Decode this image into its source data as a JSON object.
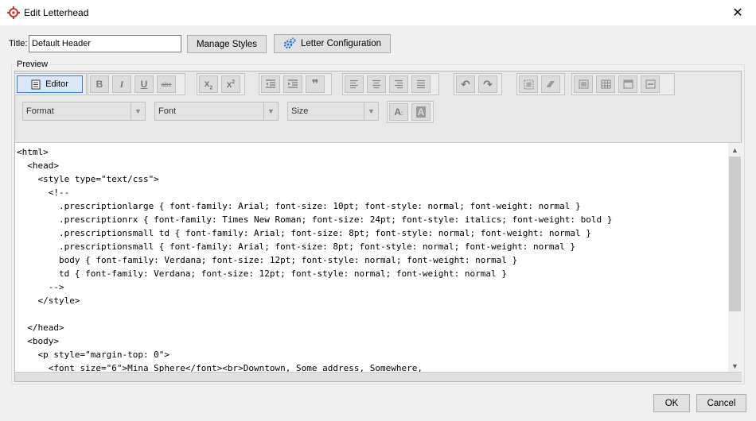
{
  "window": {
    "title": "Edit Letterhead",
    "app_icon": "target-crosshair-icon",
    "close_label": "✕"
  },
  "form": {
    "title_label": "Title:",
    "title_value": "Default Header",
    "manage_styles_label": "Manage Styles",
    "letter_config_label": "Letter Configuration",
    "preview_label": "Preview"
  },
  "toolbar": {
    "editor_label": "Editor",
    "format_selected": "Format",
    "font_selected": "Font",
    "size_selected": "Size"
  },
  "code_lines": [
    "<html>",
    "  <head>",
    "    <style type=\"text/css\">",
    "      <!--",
    "        .prescriptionlarge { font-family: Arial; font-size: 10pt; font-style: normal; font-weight: normal }",
    "        .prescriptionrx { font-family: Times New Roman; font-size: 24pt; font-style: italics; font-weight: bold }",
    "        .prescriptionsmall td { font-family: Arial; font-size: 8pt; font-style: normal; font-weight: normal }",
    "        .prescriptionsmall { font-family: Arial; font-size: 8pt; font-style: normal; font-weight: normal }",
    "        body { font-family: Verdana; font-size: 12pt; font-style: normal; font-weight: normal }",
    "        td { font-family: Verdana; font-size: 12pt; font-style: normal; font-weight: normal }",
    "      -->",
    "    </style>",
    "",
    "  </head>",
    "  <body>",
    "    <p style=\"margin-top: 0\">",
    "      <font size=\"6\">Mina Sphere</font><br>Downtown, Some address, Somewhere,"
  ],
  "footer": {
    "ok_label": "OK",
    "cancel_label": "Cancel"
  },
  "colors": {
    "accent": "#3a7bd5",
    "icon_red": "#c0392b",
    "gear_blue": "#2b6cc4"
  }
}
